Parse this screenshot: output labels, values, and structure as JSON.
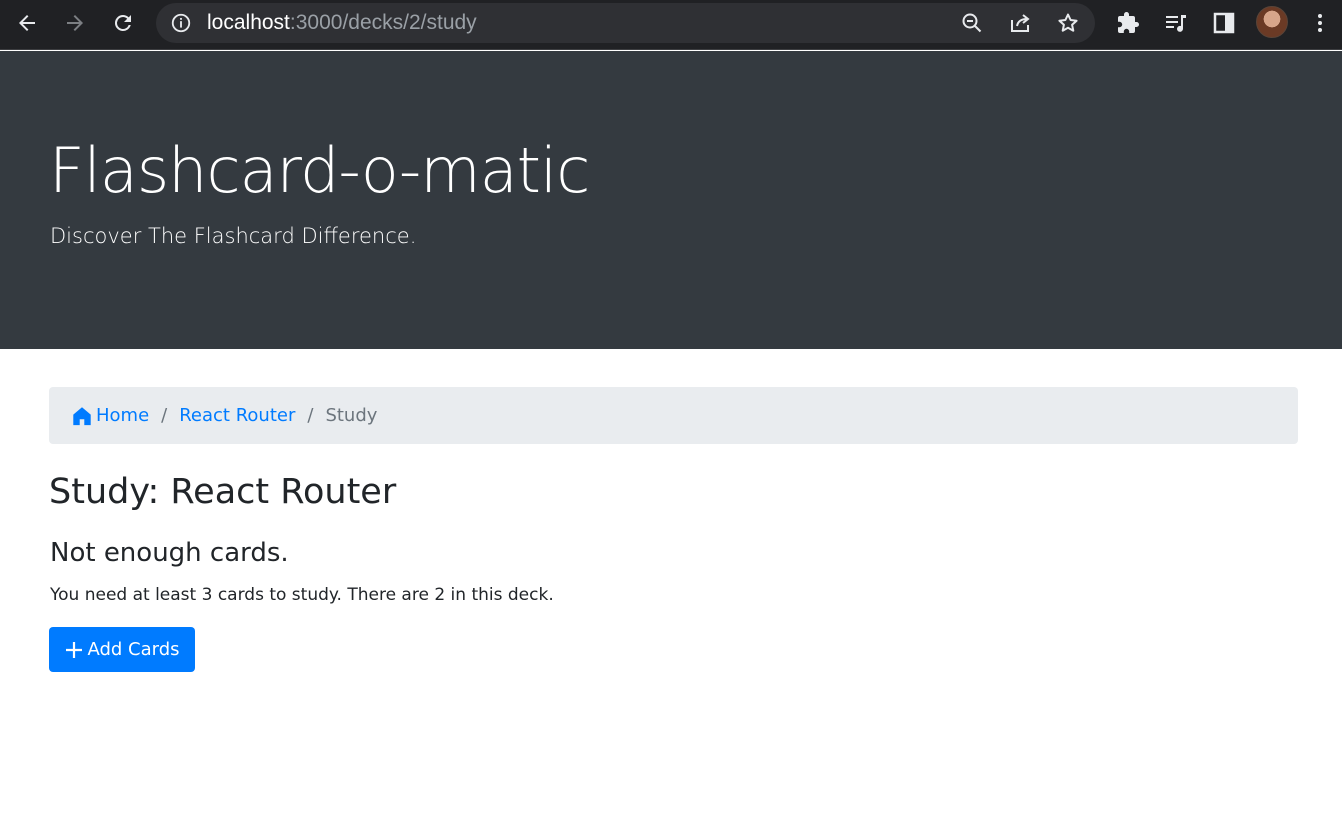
{
  "browser": {
    "url_host": "localhost",
    "url_rest": ":3000/decks/2/study",
    "icons": [
      "back-arrow-icon",
      "forward-arrow-icon",
      "reload-icon",
      "info-icon",
      "zoom-out-icon",
      "share-icon",
      "bookmark-star-icon",
      "extensions-puzzle-icon",
      "media-queue-icon",
      "side-panel-icon",
      "profile-avatar",
      "more-menu-icon"
    ]
  },
  "header": {
    "title": "Flashcard-o-matic",
    "tagline": "Discover The Flashcard Difference."
  },
  "breadcrumb": {
    "home_label": "Home",
    "deck_label": "React Router",
    "current_label": "Study",
    "separator": "/"
  },
  "main": {
    "title": "Study: React Router",
    "subtitle": "Not enough cards.",
    "message": "You need at least 3 cards to study. There are 2 in this deck.",
    "add_button_label": "Add Cards"
  },
  "colors": {
    "chrome_bg": "#202124",
    "jumbotron_bg": "#343a40",
    "link": "#007bff",
    "primary_button": "#007bff",
    "breadcrumb_bg": "#e9ecef"
  }
}
